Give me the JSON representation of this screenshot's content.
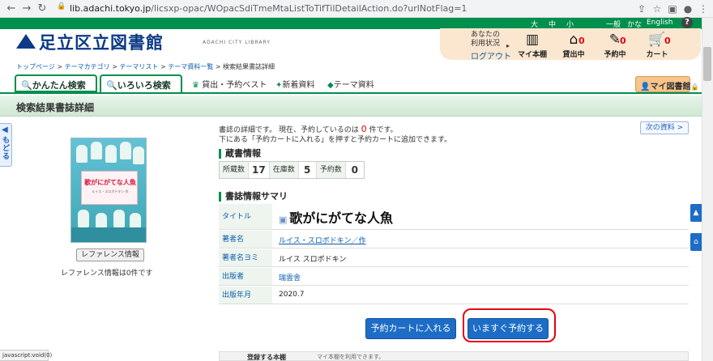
{
  "browser": {
    "url_host": "lib.adachi.tokyo.jp",
    "url_path": "/licsxp-opac/WOpacSdiTmeMtaListToTifTilDetailAction.do?urlNotFlag=1"
  },
  "top_strip": {
    "font_sizes": [
      "大",
      "中",
      "小"
    ],
    "lang_links": [
      "一般",
      "かな",
      "English"
    ],
    "help": "?"
  },
  "header": {
    "logo": "足立区立図書館",
    "logo_sub": "ADACHI CITY LIBRARY"
  },
  "user_panel": {
    "status_line1": "あなたの",
    "status_line2": "利用状況",
    "logout": "ログアウト",
    "items": [
      {
        "label": "マイ本棚",
        "count": ""
      },
      {
        "label": "貸出中",
        "count": "0"
      },
      {
        "label": "予約中",
        "count": "0"
      },
      {
        "label": "カート",
        "count": "0"
      }
    ]
  },
  "breadcrumb": {
    "items": [
      "トップページ",
      "テーマカテゴリ",
      "テーマリスト",
      "テーマ資料一覧"
    ],
    "sep": " > ",
    "current": "検索結果書誌詳細"
  },
  "tabs": {
    "easy": "かんたん検索",
    "various": "いろいろ検索",
    "best": "貸出・予約ベスト",
    "new": "新着資料",
    "theme": "テーマ資料",
    "mylib": "マイ図書館"
  },
  "page_title": "検索結果書誌詳細",
  "back_tab": "もどる",
  "cover": {
    "title": "歌がにがてな人魚",
    "subtitle": "ルイス・スロボドキン 作"
  },
  "reference": {
    "button": "レファレンス情報",
    "note": "レファレンス情報は0件です"
  },
  "intro": {
    "line1_pre": "書誌の詳細です。 現在、予約しているのは",
    "count": "0",
    "line1_post": "件です。",
    "line2": "下にある「予約カートに入れる」を押すと予約カートに追加できます。"
  },
  "next_button": "次の資料 >",
  "holdings": {
    "heading": "蔵書情報",
    "cells": [
      {
        "label": "所蔵数",
        "value": "17"
      },
      {
        "label": "在庫数",
        "value": "5"
      },
      {
        "label": "予約数",
        "value": "0"
      }
    ]
  },
  "summary": {
    "heading": "書誌情報サマリ",
    "title_label": "タイトル",
    "title": "歌がにがてな人魚",
    "author_label": "著者名",
    "author": "ルイス・スロボドキン／作",
    "author_yomi_label": "著者名ヨミ",
    "author_yomi": "ルイス スロボドキン",
    "publisher_label": "出版者",
    "publisher": "瑞雲舎",
    "year_label": "出版年月",
    "year": "2020.7"
  },
  "actions": {
    "cart": "予約カートに入れる",
    "reserve": "いますぐ予約する"
  },
  "status_bar": "javascript:void(0)",
  "bottom_box": {
    "title": "登録する本棚",
    "sub": "マイ本棚を利用できます。"
  },
  "colors": {
    "brand_green": "#008f4c",
    "brand_blue": "#0b3a86",
    "button_blue": "#1d6dc6",
    "highlight_red": "#e60012"
  }
}
